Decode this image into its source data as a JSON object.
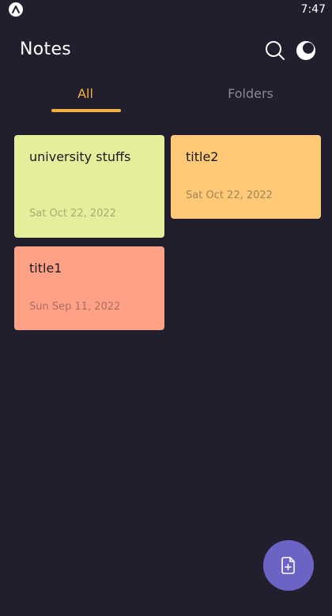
{
  "status_bar": {
    "time": "7:47",
    "app_icon": "app-logo-icon"
  },
  "header": {
    "title": "Notes",
    "search_icon": "search-icon",
    "theme_icon": "moon-icon"
  },
  "tabs": [
    {
      "label": "All",
      "active": true
    },
    {
      "label": "Folders",
      "active": false
    }
  ],
  "notes": [
    {
      "title": "university stuffs",
      "date": "Sat Oct 22, 2022",
      "color": "#e4ee9b",
      "date_color": "#a6ad74"
    },
    {
      "title": "title2",
      "date": "Sat Oct 22, 2022",
      "color": "#ffc978",
      "date_color": "#a38556"
    },
    {
      "title": "title1",
      "date": "Sun Sep 11, 2022",
      "color": "#ffa187",
      "date_color": "#ab6f60"
    }
  ],
  "fab": {
    "icon": "add-note-icon"
  },
  "colors": {
    "background": "#211f2d",
    "accent": "#f2b13f",
    "inactive_tab": "#8a8896",
    "fab": "#6c64c4"
  }
}
